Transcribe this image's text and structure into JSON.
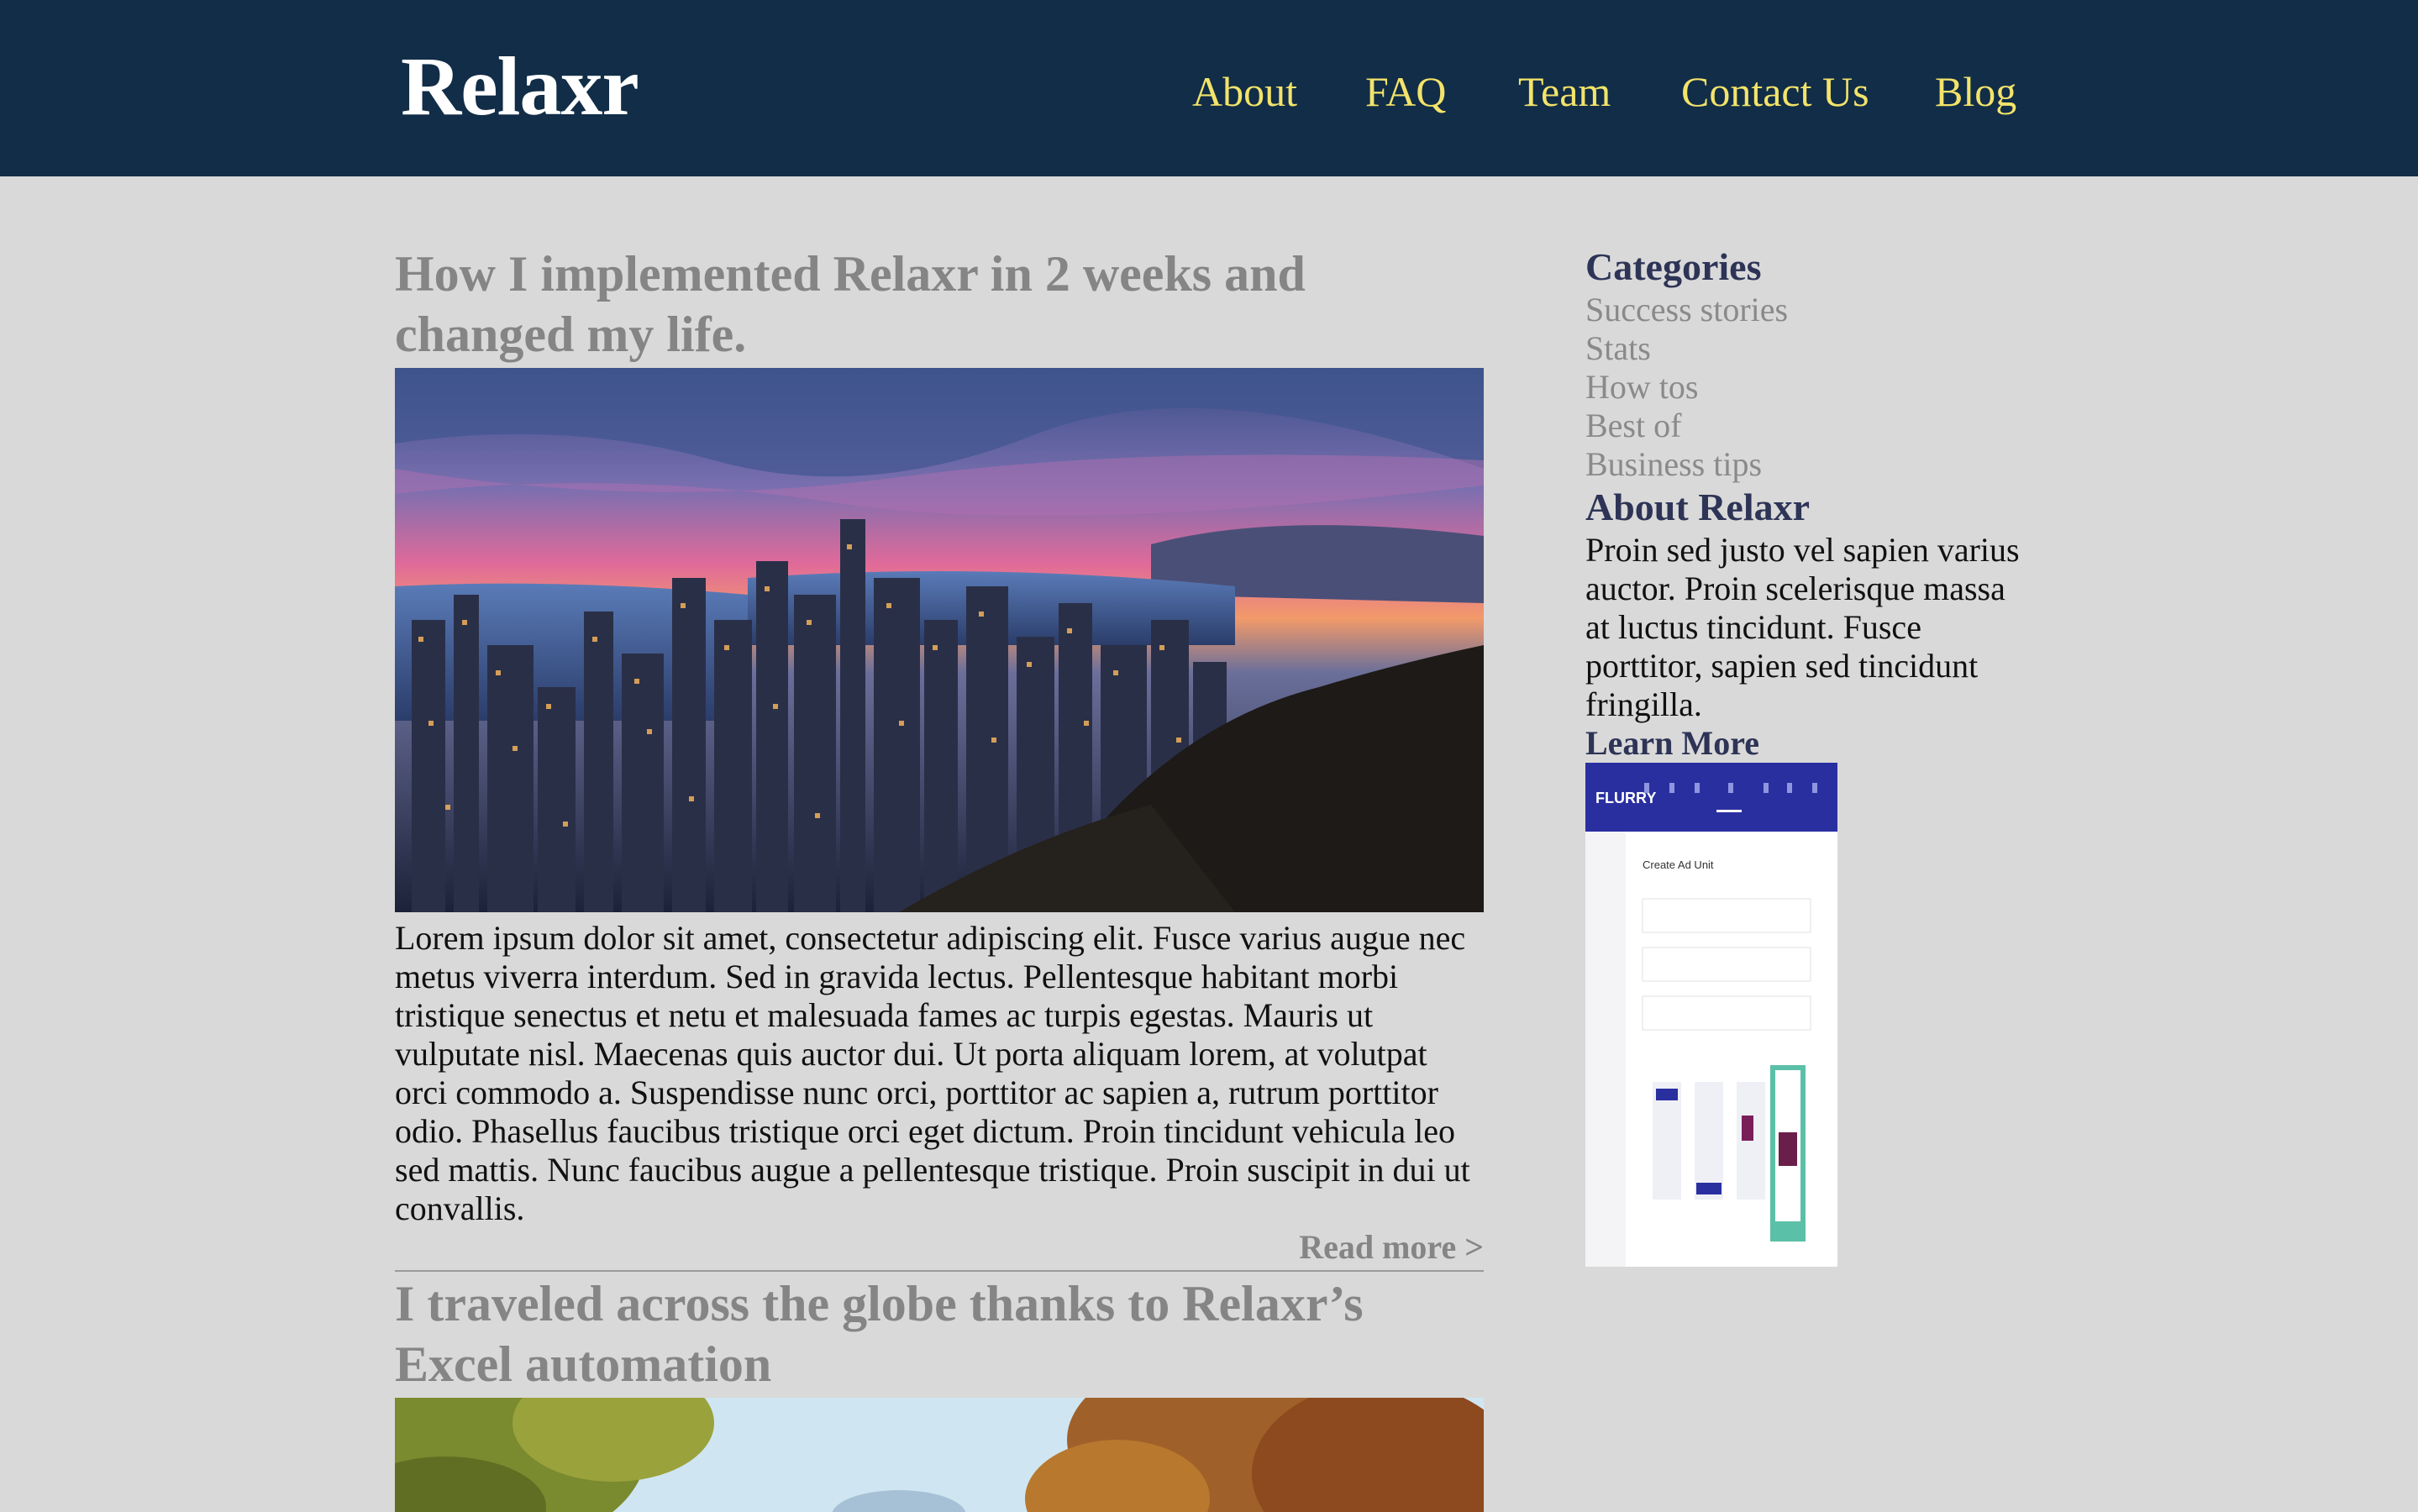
{
  "header": {
    "brand": "Relaxr",
    "nav": [
      "About",
      "FAQ",
      "Team",
      "Contact Us",
      "Blog"
    ]
  },
  "posts": [
    {
      "title": "How I implemented Relaxr in 2 weeks and changed my life.",
      "body": "Lorem ipsum dolor sit amet, consectetur adipiscing elit. Fusce varius augue nec metus viverra interdum. Sed in gravida lectus. Pellentesque habitant morbi tristique senectus et netu et malesuada fames ac turpis egestas. Mauris ut vulputate nisl. Maecenas quis auctor dui. Ut porta aliquam lorem, at volutpat orci commodo a. Suspendisse nunc orci, porttitor ac sapien a, rutrum porttitor odio. Phasellus faucibus tristique orci eget dictum. Proin tincidunt vehicula leo sed mattis. Nunc faucibus augue a pellentesque tristique. Proin suscipit in dui ut convallis.",
      "read_more": "Read more >"
    },
    {
      "title": "I traveled across the globe thanks to Relaxr’s Excel automation"
    }
  ],
  "sidebar": {
    "categories_heading": "Categories",
    "categories": [
      "Success stories",
      "Stats",
      "How tos",
      "Best of",
      "Business tips"
    ],
    "about_heading": "About Relaxr",
    "about_text": "Proin sed justo vel sapien varius auctor. Proin scelerisque massa at luctus tincidunt. Fusce porttitor, sapien sed tincidunt fringilla.",
    "learn_more": "Learn More",
    "ad": {
      "brand": "FLURRY",
      "title": "Create Ad Unit"
    }
  },
  "colors": {
    "header_bg": "#112d47",
    "nav_link": "#f3e36a",
    "page_bg": "#d9d9d9",
    "heading_gray": "#858585",
    "sidebar_heading": "#2e3456"
  }
}
